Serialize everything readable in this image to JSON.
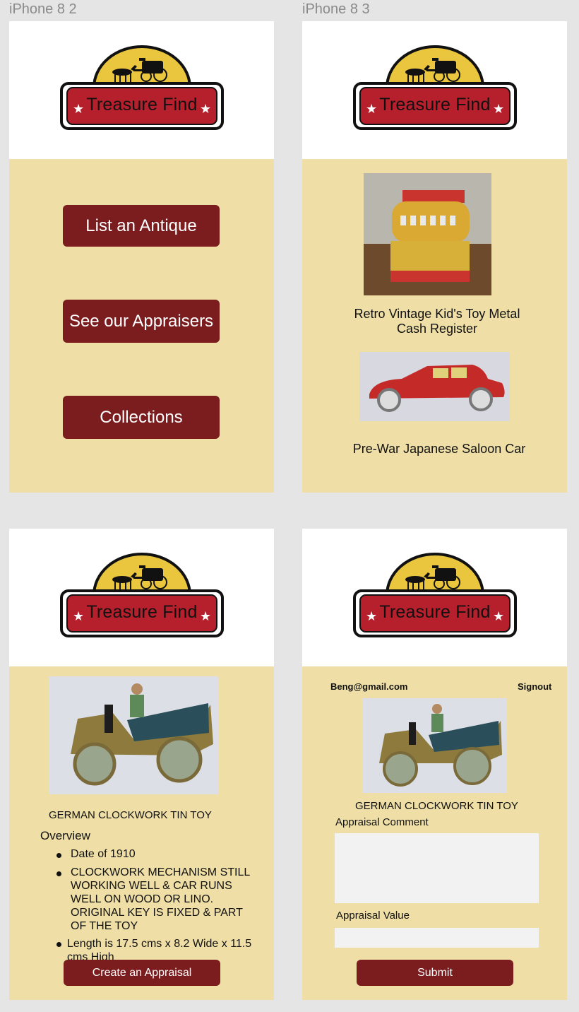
{
  "artboards": {
    "a2_label": "iPhone 8 2",
    "a3_label": "iPhone 8 3"
  },
  "brand": {
    "logo_text": "Treasure Find",
    "colors": {
      "maroon": "#7b1c1f",
      "cream": "#efdfa6",
      "red": "#b61f2c",
      "gold": "#e9c63e"
    }
  },
  "menu": {
    "list_antique": "List an Antique",
    "see_appraisers": "See our Appraisers",
    "collections": "Collections"
  },
  "collection": {
    "item1_title": "Retro Vintage Kid's Toy Metal Cash Register",
    "item2_title": "Pre-War Japanese Saloon Car"
  },
  "detail": {
    "title": "GERMAN CLOCKWORK TIN TOY",
    "overview_heading": "Overview",
    "bullets": [
      "Date of 1910",
      "CLOCKWORK MECHANISM STILL WORKING WELL & CAR RUNS WELL ON WOOD OR LINO.  ORIGINAL KEY IS FIXED & PART OF THE TOY",
      "Length is 17.5 cms x 8.2 Wide x 11.5 cms High"
    ],
    "create_button": "Create an Appraisal"
  },
  "appraisal": {
    "user_email": "Beng@gmail.com",
    "signout": "Signout",
    "title": "GERMAN CLOCKWORK TIN TOY",
    "comment_label": "Appraisal Comment",
    "comment_value": "",
    "value_label": "Appraisal Value",
    "value_value": "",
    "submit": "Submit"
  }
}
